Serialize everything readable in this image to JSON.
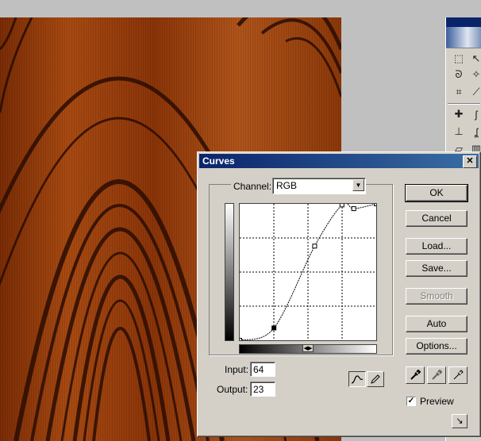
{
  "dialog": {
    "title": "Curves",
    "close_glyph": "✕",
    "channel_label": "Channel:",
    "channel_value": "RGB",
    "input_label": "Input:",
    "input_value": "64",
    "output_label": "Output:",
    "output_value": "23",
    "preview_label": "Preview",
    "preview_checked": true
  },
  "buttons": {
    "ok": "OK",
    "cancel": "Cancel",
    "load": "Load...",
    "save": "Save...",
    "smooth": "Smooth",
    "auto": "Auto",
    "options": "Options..."
  },
  "curve": {
    "points": [
      [
        0,
        0
      ],
      [
        64,
        23
      ],
      [
        140,
        176
      ],
      [
        191,
        253
      ],
      [
        213,
        246
      ],
      [
        255,
        255
      ]
    ],
    "selected_point": [
      64,
      23
    ]
  },
  "icons": {
    "channel_arrow": "dropdown-arrow-icon",
    "curve_mode": "curve-icon",
    "pencil_mode": "pencil-icon",
    "black_eyedropper": "eyedropper-black-icon",
    "gray_eyedropper": "eyedropper-gray-icon",
    "white_eyedropper": "eyedropper-white-icon",
    "resize": "expand-dialog-icon"
  }
}
